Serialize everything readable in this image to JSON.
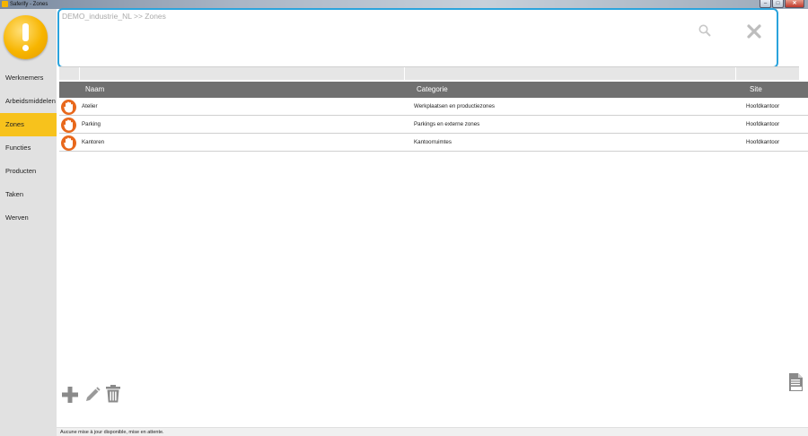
{
  "window": {
    "title": "Saferify - Zones",
    "controls": {
      "minimize": "–",
      "maximize": "□",
      "close": "✕"
    }
  },
  "sidebar": {
    "logo_icon": "exclamation-warning-icon",
    "items": [
      {
        "label": "Werknemers",
        "active": false
      },
      {
        "label": "Arbeidsmiddelen",
        "active": false
      },
      {
        "label": "Zones",
        "active": true
      },
      {
        "label": "Functies",
        "active": false
      },
      {
        "label": "Producten",
        "active": false
      },
      {
        "label": "Taken",
        "active": false
      },
      {
        "label": "Werven",
        "active": false
      }
    ]
  },
  "search": {
    "breadcrumb": "DEMO_industrie_NL >> Zones",
    "search_icon": "search-icon",
    "clear_icon": "close-icon"
  },
  "table": {
    "columns": [
      "Naam",
      "Categorie",
      "Site"
    ],
    "rows": [
      {
        "icon": "hand-stop-icon",
        "naam": "Atelier",
        "categorie": "Werkplaatsen en productiezones",
        "site": "Hoofdkantoor"
      },
      {
        "icon": "hand-stop-icon",
        "naam": "Parking",
        "categorie": "Parkings en externe zones",
        "site": "Hoofdkantoor"
      },
      {
        "icon": "hand-stop-icon",
        "naam": "Kantoren",
        "categorie": "Kantoorruimtes",
        "site": "Hoofdkantoor"
      }
    ]
  },
  "tools": {
    "add_icon": "plus-icon",
    "edit_icon": "pencil-icon",
    "delete_icon": "trash-icon",
    "export_icon": "document-export-icon"
  },
  "status": {
    "text": "Aucune mise à jour disponible, mise en attente."
  },
  "colors": {
    "accent": "#2aa3dc",
    "active_nav": "#f7c21c",
    "row_icon": "#e8681c",
    "header_bg": "#707070"
  }
}
